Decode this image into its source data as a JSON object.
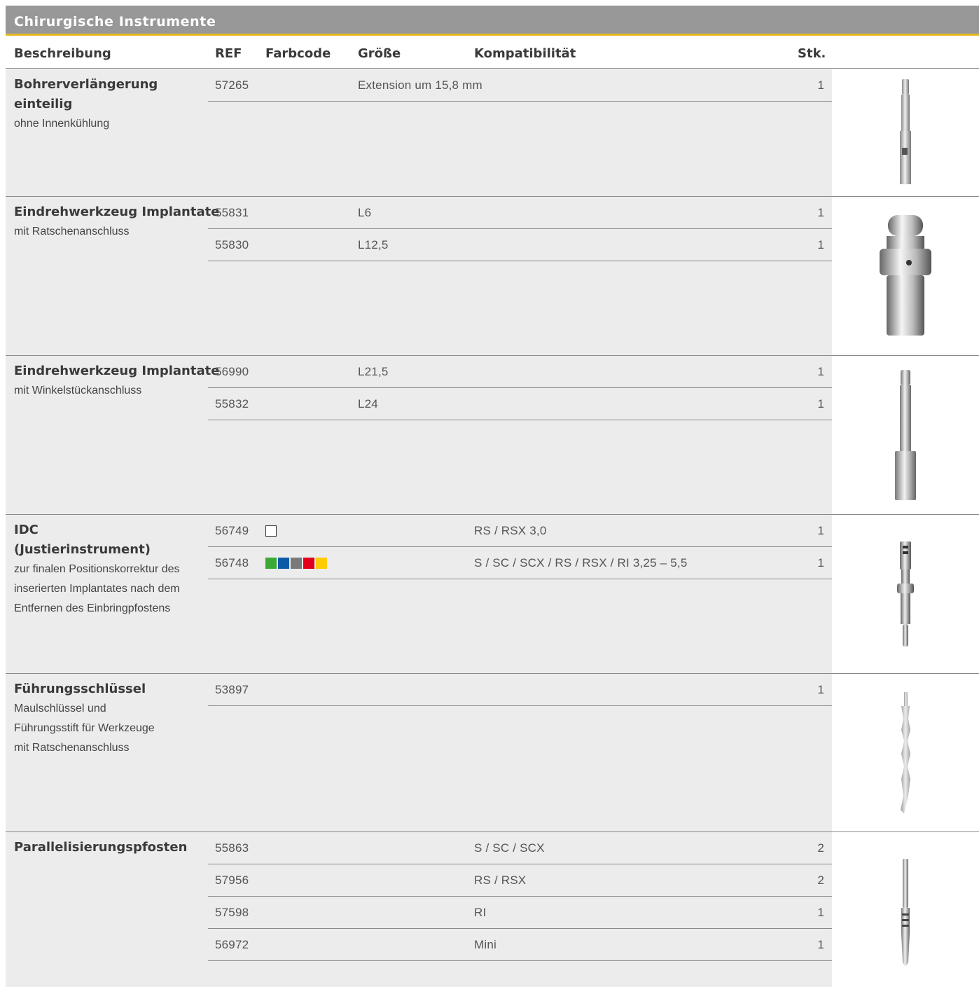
{
  "title": "Chirurgische Instrumente",
  "columns": {
    "description": "Beschreibung",
    "ref": "REF",
    "farbcode": "Farbcode",
    "size": "Größe",
    "compat": "Kompatibilität",
    "qty": "Stk."
  },
  "sections": [
    {
      "title_lines": [
        "Bohrerverlängerung",
        "einteilig"
      ],
      "sub_lines": [
        "ohne Innenkühlung"
      ],
      "image": "drill-extension-icon",
      "rows": [
        {
          "ref": "57265",
          "size": "Extension um 15,8 mm",
          "compat": "",
          "qty": "1"
        }
      ]
    },
    {
      "title_lines": [
        "Eindrehwerkzeug Implantate"
      ],
      "sub_lines": [
        "mit Ratschenanschluss"
      ],
      "image": "ratchet-insertion-tool-icon",
      "rows": [
        {
          "ref": "55831",
          "size": "L6",
          "compat": "",
          "qty": "1"
        },
        {
          "ref": "55830",
          "size": "L12,5",
          "compat": "",
          "qty": "1"
        }
      ]
    },
    {
      "title_lines": [
        "Eindrehwerkzeug Implantate"
      ],
      "sub_lines": [
        "mit Winkelstückanschluss"
      ],
      "image": "contra-angle-insertion-tool-icon",
      "rows": [
        {
          "ref": "56990",
          "size": "L21,5",
          "compat": "",
          "qty": "1"
        },
        {
          "ref": "55832",
          "size": "L24",
          "compat": "",
          "qty": "1"
        }
      ]
    },
    {
      "title_lines": [
        "IDC",
        "(Justierinstrument)"
      ],
      "sub_lines": [
        "zur finalen Positionskorrektur des",
        "inserierten Implantates nach dem",
        "Entfernen des Einbringpfostens"
      ],
      "image": "idc-adjustment-instrument-icon",
      "rows": [
        {
          "ref": "56749",
          "size": "",
          "compat": "RS / RSX    3,0",
          "qty": "1",
          "colors": [
            "#ffffff"
          ]
        },
        {
          "ref": "56748",
          "size": "",
          "compat": "S / SC / SCX / RS / RSX / RI    3,25 – 5,5",
          "qty": "1",
          "colors": [
            "#3aaa35",
            "#0a5aa8",
            "#7a7a7a",
            "#e2001a",
            "#ffcc00"
          ]
        }
      ]
    },
    {
      "title_lines": [
        "Führungsschlüssel"
      ],
      "sub_lines": [
        "Maulschlüssel und",
        "Führungsstift für Werkzeuge",
        "mit Ratschenanschluss"
      ],
      "image": "guide-key-icon",
      "rows": [
        {
          "ref": "53897",
          "size": "",
          "compat": "",
          "qty": "1"
        }
      ]
    },
    {
      "title_lines": [
        "Parallelisierungspfosten"
      ],
      "sub_lines": [],
      "image": "parallel-post-icon",
      "rows": [
        {
          "ref": "55863",
          "size": "",
          "compat": "S / SC / SCX",
          "qty": "2"
        },
        {
          "ref": "57956",
          "size": "",
          "compat": "RS / RSX",
          "qty": "2"
        },
        {
          "ref": "57598",
          "size": "",
          "compat": "RI",
          "qty": "1"
        },
        {
          "ref": "56972",
          "size": "",
          "compat": "Mini",
          "qty": "1"
        }
      ]
    }
  ]
}
